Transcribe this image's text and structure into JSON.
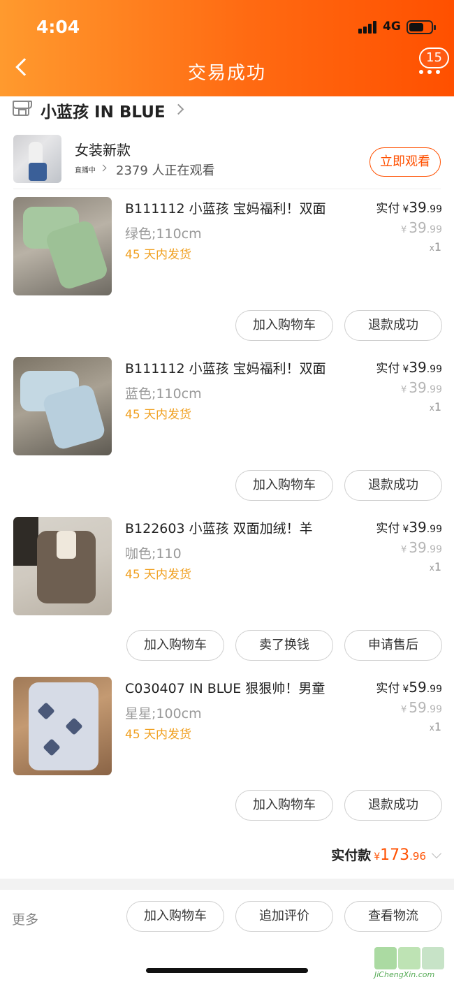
{
  "status_bar": {
    "time": "4:04",
    "network": "4G"
  },
  "header": {
    "title": "交易成功",
    "badge_count": "15"
  },
  "shop": {
    "name": "小蓝孩 IN BLUE"
  },
  "live": {
    "title": "女装新款",
    "tag": "直播中",
    "viewers": "2379 人正在观看",
    "watch_button": "立即观看"
  },
  "items": [
    {
      "name": "B111112 小蓝孩 宝妈福利！双面",
      "spec": "绿色;110cm",
      "ship": "45 天内发货",
      "paid_label": "实付",
      "currency": "¥",
      "price_int": "39",
      "price_dec": ".99",
      "orig_int": "39",
      "orig_dec": ".99",
      "qty_x": "x",
      "qty": "1",
      "buttons": [
        "加入购物车",
        "退款成功"
      ],
      "thumb_color": "#9fc29b"
    },
    {
      "name": "B111112 小蓝孩 宝妈福利！双面",
      "spec": "蓝色;110cm",
      "ship": "45 天内发货",
      "paid_label": "实付",
      "currency": "¥",
      "price_int": "39",
      "price_dec": ".99",
      "orig_int": "39",
      "orig_dec": ".99",
      "qty_x": "x",
      "qty": "1",
      "buttons": [
        "加入购物车",
        "退款成功"
      ],
      "thumb_color": "#bcd2df"
    },
    {
      "name": "B122603 小蓝孩 双面加绒！羊",
      "spec": "咖色;110",
      "ship": "45 天内发货",
      "paid_label": "实付",
      "currency": "¥",
      "price_int": "39",
      "price_dec": ".99",
      "orig_int": "39",
      "orig_dec": ".99",
      "qty_x": "x",
      "qty": "1",
      "buttons": [
        "加入购物车",
        "卖了换钱",
        "申请售后"
      ],
      "thumb_color": "#7a6a5c"
    },
    {
      "name": "C030407 IN BLUE 狠狠帅！男童",
      "spec": "星星;100cm",
      "ship": "45 天内发货",
      "paid_label": "实付",
      "currency": "¥",
      "price_int": "59",
      "price_dec": ".99",
      "orig_int": "59",
      "orig_dec": ".99",
      "qty_x": "x",
      "qty": "1",
      "buttons": [
        "加入购物车",
        "退款成功"
      ],
      "thumb_color": "#c9cfdc"
    }
  ],
  "total": {
    "label": "实付款",
    "currency": "¥",
    "int": "173",
    "dec": ".96"
  },
  "footer": {
    "more": "更多",
    "buttons": [
      "加入购物车",
      "追加评价",
      "查看物流"
    ]
  },
  "watermark": {
    "text": "JiChengXin.com"
  },
  "colors": {
    "accent": "#ff5000",
    "ship": "#f0a020"
  }
}
